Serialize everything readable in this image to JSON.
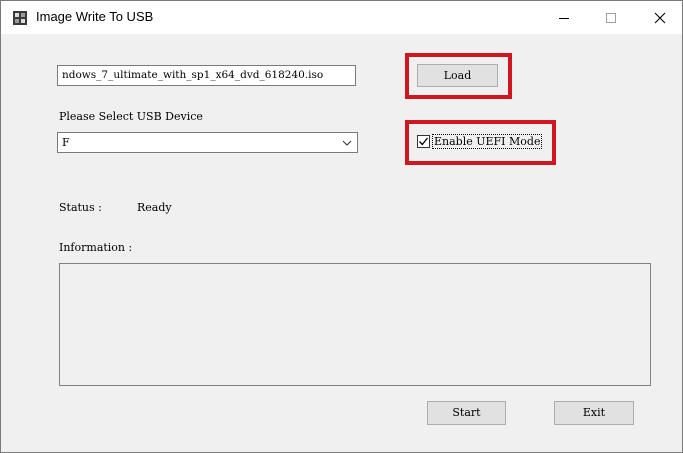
{
  "window": {
    "title": "Image Write To USB"
  },
  "title_bar": {
    "minimize_icon": "minimize-icon",
    "maximize_icon": "maximize-icon",
    "close_icon": "close-icon"
  },
  "image_path": {
    "value": "ndows_7_ultimate_with_sp1_x64_dvd_618240.iso"
  },
  "buttons": {
    "load": "Load",
    "start": "Start",
    "exit": "Exit"
  },
  "usb": {
    "label": "Please Select USB Device",
    "selected": "F"
  },
  "uefi": {
    "label": "Enable UEFI Mode",
    "checked": true
  },
  "status": {
    "label": "Status :",
    "value": "Ready"
  },
  "information": {
    "label": "Information :",
    "content": ""
  },
  "colors": {
    "highlight": "#d0161e",
    "window_bg": "#f0f0f0",
    "button_bg": "#e1e1e1"
  }
}
